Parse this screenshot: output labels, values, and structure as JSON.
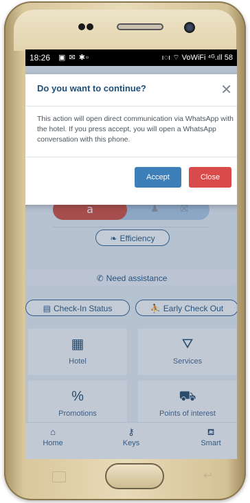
{
  "status_bar": {
    "time": "18:26",
    "left_icons": "▣ ✉ ✱▫",
    "right_icons": "ı◌ı ⌔ VoWiFi ⁴ᴳ.ıll 58"
  },
  "modal": {
    "title": "Do you want to continue?",
    "close_glyph": "✕",
    "body": "This action will open direct communication via WhatsApp with the hotel. If you press accept, you will open a WhatsApp conversation with this phone.",
    "accept_label": "Accept",
    "close_label": "Close",
    "accept_color": "#3d7fb8",
    "close_color": "#d94a4a"
  },
  "mode_toggle": {
    "active_icon": "a",
    "options": [
      "person-standing-icon",
      "cleaning-cart-icon"
    ]
  },
  "efficiency": {
    "label": "Efficiency",
    "icon": "leaf-icon"
  },
  "assistance": {
    "label": "Need assistance",
    "icon": "phone-icon"
  },
  "checkin": {
    "label": "Check-In Status",
    "icon": "id-card-icon"
  },
  "early_checkout": {
    "label": "Early Check Out",
    "icon": "running-person-icon"
  },
  "tiles": [
    {
      "label": "Hotel",
      "icon": "building-icon",
      "glyph": "▦"
    },
    {
      "label": "Services",
      "icon": "service-bell-icon",
      "glyph": "⛛"
    },
    {
      "label": "Promotions",
      "icon": "percent-icon",
      "glyph": "%"
    },
    {
      "label": "Points of interest",
      "icon": "car-icon",
      "glyph": "⛟"
    }
  ],
  "nav": {
    "home": "Home",
    "keys": "Keys",
    "smart": "Smart"
  }
}
